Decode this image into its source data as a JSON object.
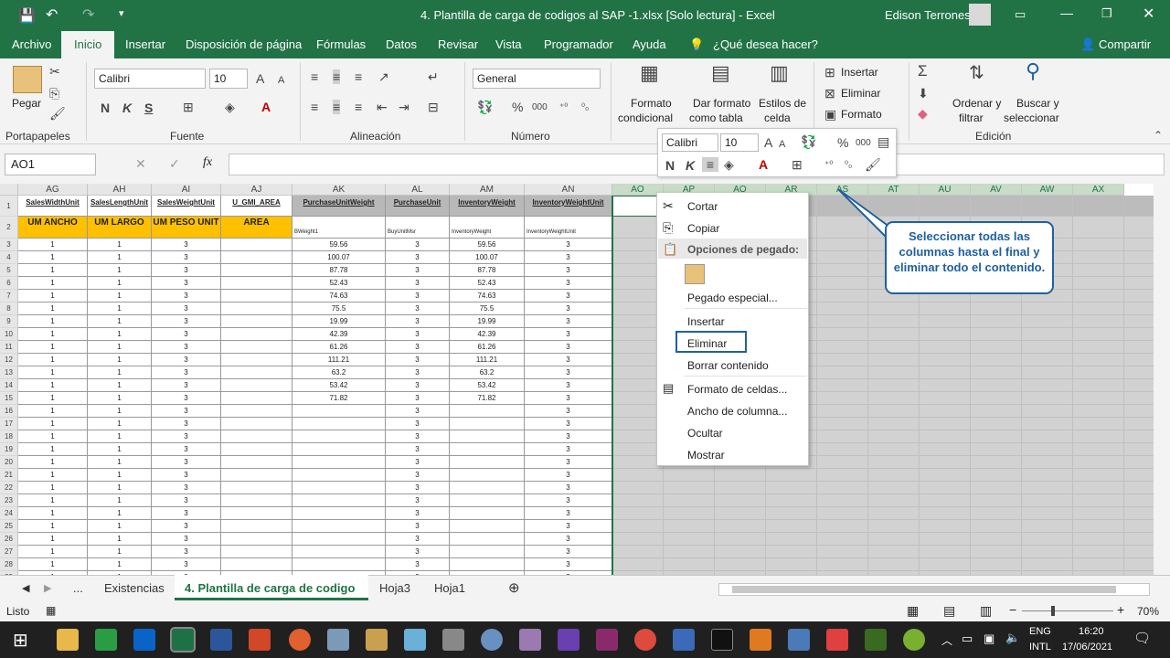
{
  "title": {
    "file": "4. Plantilla de carga de codigos al SAP -1.xlsx  [Solo lectura]  -  Excel",
    "user": "Edison Terrones"
  },
  "tabs": [
    "Archivo",
    "Inicio",
    "Insertar",
    "Disposición de página",
    "Fórmulas",
    "Datos",
    "Revisar",
    "Vista",
    "Programador",
    "Ayuda",
    "¿Qué desea hacer?"
  ],
  "share": "Compartir",
  "ribbon": {
    "paste": "Pegar",
    "font_name": "Calibri",
    "font_size": "10",
    "number_format": "General",
    "cond_format": [
      "Formato",
      "condicional"
    ],
    "table_format": [
      "Dar formato",
      "como tabla"
    ],
    "cell_styles": [
      "Estilos de",
      "celda"
    ],
    "insert": "Insertar",
    "delete": "Eliminar",
    "format": "Formato",
    "sort": [
      "Ordenar y",
      "filtrar"
    ],
    "find": [
      "Buscar y",
      "seleccionar"
    ],
    "groups": [
      "Portapapeles",
      "Fuente",
      "Alineación",
      "Número",
      "Edición"
    ]
  },
  "namebox": "AO1",
  "columns": {
    "left": [
      "AG",
      "AH",
      "AI",
      "AJ",
      "AK",
      "AL",
      "AM",
      "AN"
    ],
    "right": [
      "AO",
      "AP",
      "AQ",
      "AR",
      "AS",
      "AT",
      "AU",
      "AV",
      "AW",
      "AX"
    ]
  },
  "header_row1": [
    "SalesWidthUnit",
    "SalesLengthUnit",
    "SalesWeightUnit",
    "U_GMI_AREA",
    "PurchaseUnitWeight",
    "PurchaseUnit",
    "InventoryWeight",
    "InventoryWeightUnit"
  ],
  "header_row2": [
    "UM ANCHO",
    "UM LARGO",
    "UM PESO UNIT",
    "AREA",
    "BWeight1",
    "BuyUnitMsr",
    "InventoryWeight",
    "InventoryWeightUnit"
  ],
  "weights": [
    "59.56",
    "100.07",
    "87.78",
    "52.43",
    "74.63",
    "75.5",
    "19.99",
    "42.39",
    "61.26",
    "111.21",
    "63.2",
    "53.42",
    "71.82"
  ],
  "context_menu": [
    "Cortar",
    "Copiar",
    "Opciones de pegado:",
    "Pegado especial...",
    "Insertar",
    "Eliminar",
    "Borrar contenido",
    "Formato de celdas...",
    "Ancho de columna...",
    "Ocultar",
    "Mostrar"
  ],
  "callout": "Seleccionar todas las columnas hasta el final y eliminar todo el contenido.",
  "sheet_tabs": [
    "...",
    "Existencias",
    "4. Plantilla de carga de codigo",
    "Hoja3",
    "Hoja1"
  ],
  "status": {
    "ready": "Listo",
    "zoom": "70%"
  },
  "taskbar": {
    "lang1": "ENG",
    "lang2": "INTL",
    "time": "16:20",
    "date": "17/06/2021"
  }
}
